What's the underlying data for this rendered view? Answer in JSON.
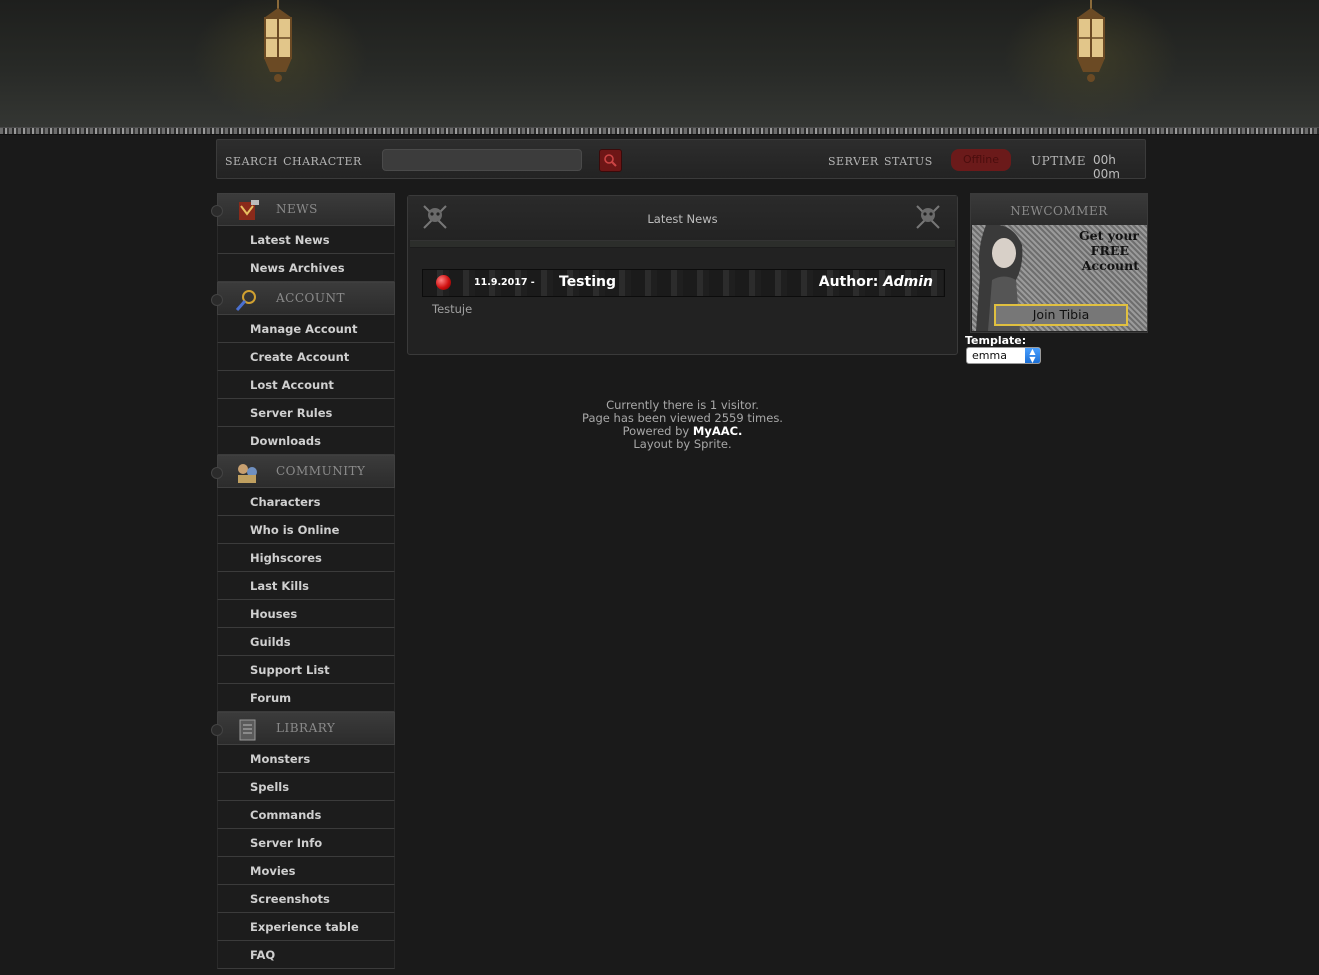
{
  "topbar": {
    "search_label": "Search Character",
    "search_placeholder": "",
    "status_label": "Server Status",
    "status_value": "Offline",
    "uptime_label": "Uptime",
    "uptime_value": "00h 00m"
  },
  "sidebar": {
    "categories": [
      {
        "title": "news",
        "icon": "news-icon",
        "items": [
          "Latest News",
          "News Archives"
        ]
      },
      {
        "title": "account",
        "icon": "account-icon",
        "items": [
          "Manage Account",
          "Create Account",
          "Lost Account",
          "Server Rules",
          "Downloads"
        ]
      },
      {
        "title": "community",
        "icon": "community-icon",
        "items": [
          "Characters",
          "Who is Online",
          "Highscores",
          "Last Kills",
          "Houses",
          "Guilds",
          "Support List",
          "Forum"
        ]
      },
      {
        "title": "library",
        "icon": "library-icon",
        "items": [
          "Monsters",
          "Spells",
          "Commands",
          "Server Info",
          "Movies",
          "Screenshots",
          "Experience table",
          "FAQ"
        ]
      }
    ]
  },
  "main": {
    "title": "Latest News",
    "news": {
      "date": "11.9.2017 -",
      "title": "Testing",
      "author_label": "Author:",
      "author": "Admin",
      "body": "Testuje"
    }
  },
  "footer": {
    "visitors": "Currently there is 1 visitor.",
    "views": "Page has been viewed 2559 times.",
    "powered_prefix": "Powered by",
    "powered_link": "MyAAC.",
    "layout": "Layout by Sprite."
  },
  "newcomer": {
    "title": "newcommer",
    "promo_lines": [
      "Get your",
      "FREE",
      "Account"
    ],
    "join_label": "Join Tibia"
  },
  "template": {
    "label": "Template:",
    "selected": "emma"
  },
  "colors": {
    "background": "#1a1a1a",
    "offline_red": "#6b1a1a",
    "news_dot": "#d01010"
  }
}
